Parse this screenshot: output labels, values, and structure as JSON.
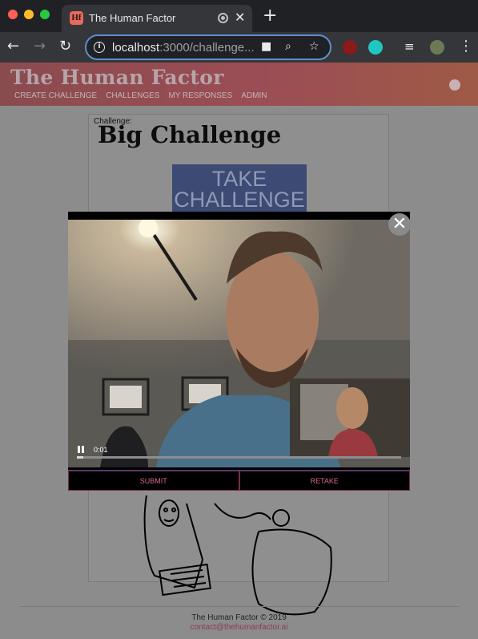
{
  "browser": {
    "tab_title": "The Human Factor",
    "tab_favicon": "Hf",
    "url_host": "localhost",
    "url_path": ":3000/challenge...",
    "accent": "#5e8fce"
  },
  "site": {
    "title": "The Human Factor",
    "nav": [
      "CREATE CHALLENGE",
      "CHALLENGES",
      "MY RESPONSES",
      "ADMIN"
    ]
  },
  "challenge": {
    "label": "Challenge:",
    "name": "Big Challenge",
    "take_button": "TAKE CHALLENGE"
  },
  "video": {
    "time": "0:01",
    "progress": 0.02
  },
  "modal": {
    "submit_label": "SUBMIT",
    "retake_label": "RETAKE"
  },
  "footer": {
    "copyright": "The Human Factor © 2019",
    "contact": "contact@thehumanfactor.ai"
  }
}
